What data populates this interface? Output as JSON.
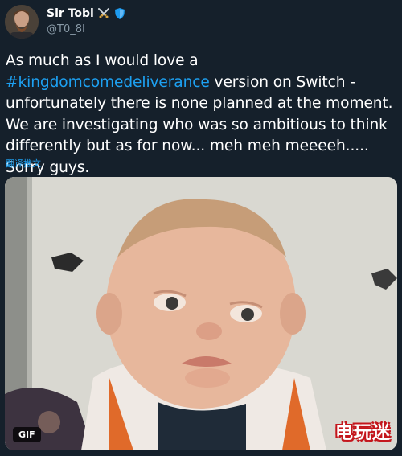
{
  "author": {
    "display_name": "Sir Tobi",
    "handle": "@T0_8I",
    "badges": [
      "crossed-swords-icon",
      "shield-icon"
    ]
  },
  "tweet": {
    "text_before": "As much as I would love a ",
    "hashtag": "#kingdomcomedeliverance",
    "text_after": " version on Switch - unfortunately there is none planned at the moment. We are investigating who was so ambitious to think differently but as for now... meh meh meeeeh..... Sorry guys.",
    "translate_label": "翻译推文"
  },
  "media": {
    "type_badge": "GIF",
    "watermark": "电玩迷"
  },
  "colors": {
    "background": "#15202b",
    "link": "#1da1f2",
    "secondary_text": "#8899a6",
    "watermark_outline": "#c4161c"
  }
}
